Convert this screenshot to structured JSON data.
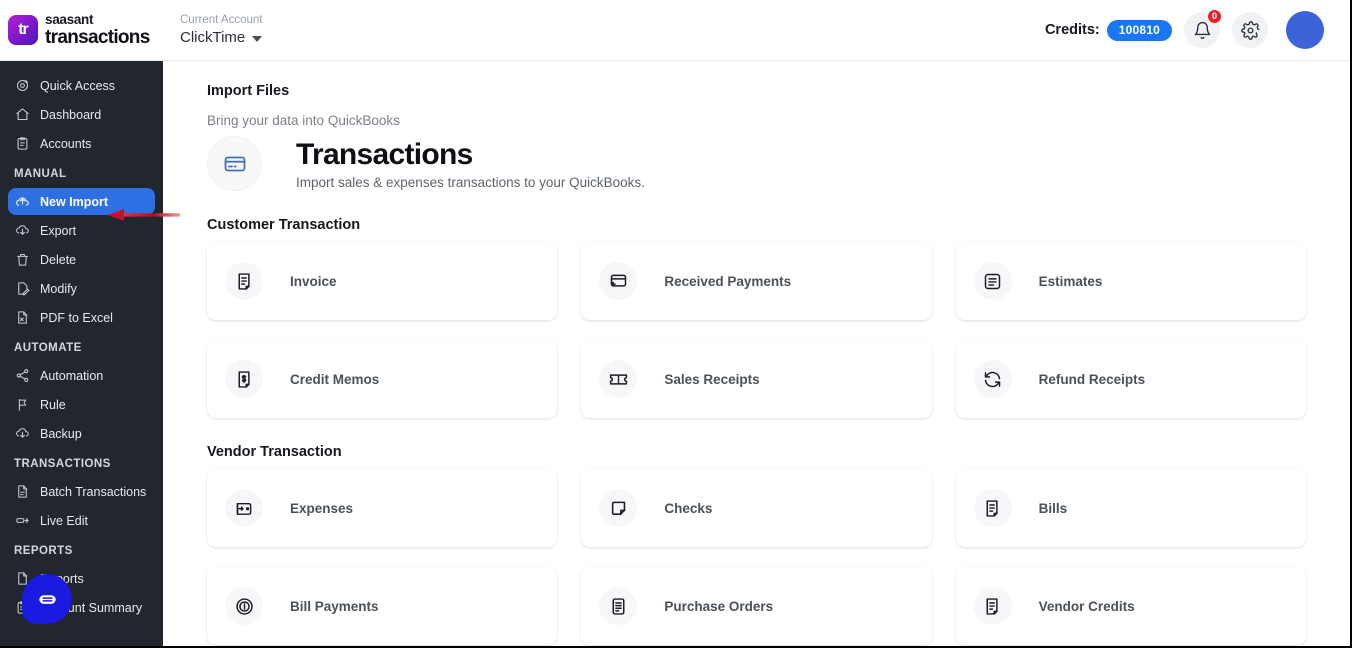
{
  "brand": {
    "logo_text": "tr",
    "name_top": "saasant",
    "name_bottom": "transactions"
  },
  "account": {
    "label": "Current Account",
    "name": "ClickTime",
    "caret_icon": "chevron-down-icon"
  },
  "topbar": {
    "credits_label": "Credits:",
    "credits_value": "100810",
    "notification_icon": "bell-icon",
    "notification_badge": "0",
    "settings_icon": "gear-icon",
    "avatar_icon": "user-avatar",
    "accent_blue": "#1877f2",
    "badge_red": "#ee1d23"
  },
  "sidebar": {
    "bg": "#22262f",
    "active_bg": "#2f6fe4",
    "groups": [
      {
        "label": "",
        "items": [
          {
            "label": "Quick Access",
            "icon": "target-icon",
            "active": false
          },
          {
            "label": "Dashboard",
            "icon": "home-icon",
            "active": false
          },
          {
            "label": "Accounts",
            "icon": "clipboard-icon",
            "active": false
          }
        ]
      },
      {
        "label": "MANUAL",
        "items": [
          {
            "label": "New Import",
            "icon": "cloud-upload-icon",
            "active": true
          },
          {
            "label": "Export",
            "icon": "cloud-download-icon",
            "active": false
          },
          {
            "label": "Delete",
            "icon": "trash-icon",
            "active": false
          },
          {
            "label": "Modify",
            "icon": "file-edit-icon",
            "active": false
          },
          {
            "label": "PDF to Excel",
            "icon": "file-pdf-icon",
            "active": false
          }
        ]
      },
      {
        "label": "AUTOMATE",
        "items": [
          {
            "label": "Automation",
            "icon": "share-nodes-icon",
            "active": false
          },
          {
            "label": "Rule",
            "icon": "rule-flag-icon",
            "active": false
          },
          {
            "label": "Backup",
            "icon": "cloud-download-icon",
            "active": false
          }
        ]
      },
      {
        "label": "TRANSACTIONS",
        "items": [
          {
            "label": "Batch Transactions",
            "icon": "document-icon",
            "active": false
          },
          {
            "label": "Live Edit",
            "icon": "live-edit-icon",
            "active": false
          }
        ]
      },
      {
        "label": "REPORTS",
        "items": [
          {
            "label": "Reports",
            "icon": "report-icon",
            "active": false
          },
          {
            "label": "Account Summary",
            "icon": "clipboard-icon",
            "active": false
          }
        ]
      }
    ]
  },
  "main": {
    "import_files_title": "Import Files",
    "import_files_sub": "Bring your data into QuickBooks",
    "hero_icon": "credit-card-icon",
    "hero_title": "Transactions",
    "hero_sub": "Import sales & expenses transactions to your QuickBooks.",
    "sections": [
      {
        "title": "Customer Transaction",
        "tiles": [
          {
            "label": "Invoice",
            "icon": "invoice-icon"
          },
          {
            "label": "Received Payments",
            "icon": "card-payment-icon"
          },
          {
            "label": "Estimates",
            "icon": "document-lines-icon"
          },
          {
            "label": "Credit Memos",
            "icon": "credit-memo-icon"
          },
          {
            "label": "Sales Receipts",
            "icon": "ticket-icon"
          },
          {
            "label": "Refund Receipts",
            "icon": "refresh-icon"
          }
        ]
      },
      {
        "title": "Vendor Transaction",
        "tiles": [
          {
            "label": "Expenses",
            "icon": "wallet-icon"
          },
          {
            "label": "Checks",
            "icon": "note-corner-icon"
          },
          {
            "label": "Bills",
            "icon": "invoice-icon"
          },
          {
            "label": "Bill Payments",
            "icon": "dollar-circle-icon"
          },
          {
            "label": "Purchase Orders",
            "icon": "purchase-order-icon"
          },
          {
            "label": "Vendor Credits",
            "icon": "invoice-icon"
          }
        ]
      }
    ]
  },
  "annotation": {
    "arrow_icon": "left-arrow-annotation",
    "color": "#c8102e",
    "points_to": "New Import"
  },
  "chat_widget": {
    "icon": "chat-message-icon",
    "color": "#1a1ae0"
  }
}
